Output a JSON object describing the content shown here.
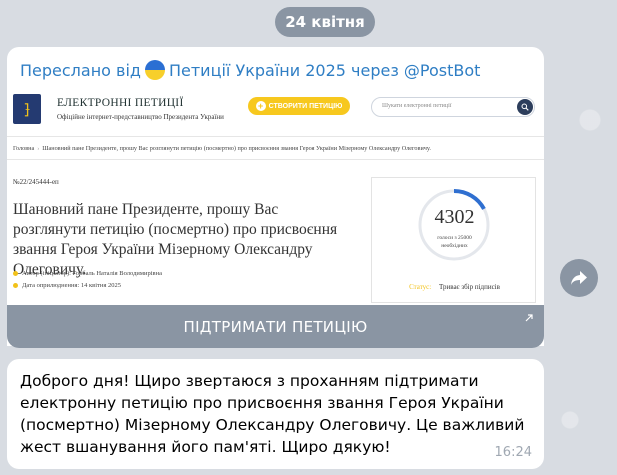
{
  "date_separator": "24 квітня",
  "forward": {
    "prefix": "Переслано від",
    "channel": "Петиції України 2025 через @PostBot"
  },
  "preview": {
    "site_title": "ЕЛЕКТРОННІ ПЕТИЦІЇ",
    "site_subtitle": "Офіційне інтернет-представництво Президента України",
    "create_button": "СТВОРИТИ ПЕТИЦІЮ",
    "search_placeholder": "Шукати електронні петиції",
    "breadcrumb": {
      "home": "Головна",
      "current": "Шановний пане Президенте, прошу Вас розглянути петицію (посмертно) про присвоєння звання Героя України Мізерному Олександру Олеговичу."
    },
    "petition_number": "№22/245444-еп",
    "petition_title": "Шановний пане Президенте, прошу Вас розглянути петицію (посмертно) про присвоєння звання Героя України Мізерному Олександру Олеговичу.",
    "author": "Автор (ініціатор): Горбаль Наталія Володимирівна",
    "published": "Дата оприлюднення: 14 квітня 2025",
    "votes": "4302",
    "votes_label_line1": "голоси з 25000",
    "votes_label_line2": "необхідних",
    "progress_fraction": 0.172,
    "status_label": "Статус:",
    "status_value": "Триває збір підписів",
    "colors": {
      "accent_yellow": "#f7c81e",
      "progress_blue": "#2f6fd0"
    }
  },
  "action_button": "ПІДТРИМАТИ ПЕТИЦІЮ",
  "message": {
    "text": "Доброго дня! Щиро звертаюся з проханням підтримати електронну петицію про присвоєння звання Героя України (посмертно) Мізерному Олександру Олеговичу. Це важливий жест вшанування його пам'яті. Щиро дякую!",
    "time": "16:24"
  }
}
